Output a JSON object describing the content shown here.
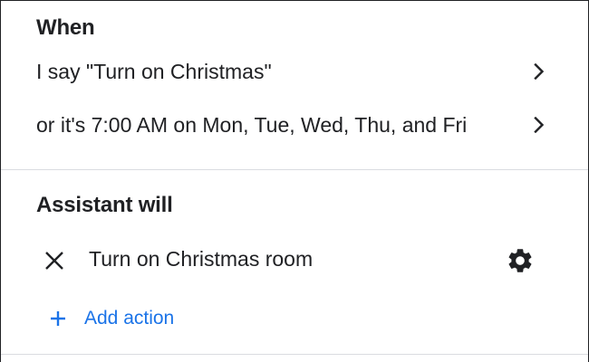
{
  "colors": {
    "text": "#202124",
    "accent": "#1a73e8",
    "divider": "#dadce0"
  },
  "when": {
    "title": "When",
    "triggers": [
      {
        "label": "I say \"Turn on Christmas\"",
        "icon": "chevron-right-icon"
      },
      {
        "label": "or it's 7:00 AM on Mon, Tue, Wed, Thu, and Fri",
        "icon": "chevron-right-icon"
      }
    ]
  },
  "assistant": {
    "title": "Assistant will",
    "actions": [
      {
        "label": "Turn on Christmas room",
        "remove_icon": "close-icon",
        "settings_icon": "gear-icon"
      }
    ],
    "add_action_label": "Add action",
    "add_icon": "plus-icon"
  }
}
